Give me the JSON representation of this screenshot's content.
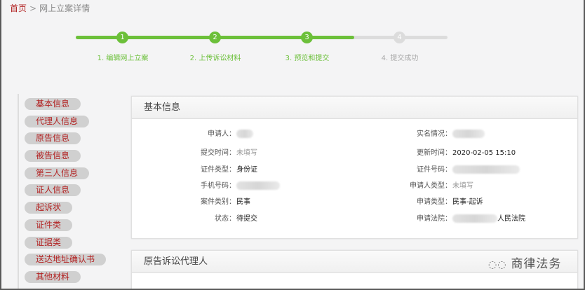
{
  "breadcrumb": {
    "home": "首页",
    "separator": ">",
    "current": "网上立案详情"
  },
  "steps": [
    {
      "num": "1",
      "label": "1. 编辑网上立案",
      "done": true
    },
    {
      "num": "2",
      "label": "2. 上传诉讼材料",
      "done": true
    },
    {
      "num": "3",
      "label": "3. 预览和提交",
      "done": true
    },
    {
      "num": "4",
      "label": "4. 提交成功",
      "done": false
    }
  ],
  "colors": {
    "accent": "#6cc03a",
    "inactive": "#dcdcdc",
    "link": "#b22222"
  },
  "sidebar": {
    "items": [
      "基本信息",
      "代理人信息",
      "原告信息",
      "被告信息",
      "第三人信息",
      "证人信息",
      "起诉状",
      "证件类",
      "证据类",
      "送达地址确认书",
      "其他材料"
    ]
  },
  "basic": {
    "title": "基本信息",
    "left": [
      {
        "label": "申请人：",
        "value": ""
      },
      {
        "label": "提交时间：",
        "value": "未填写"
      },
      {
        "label": "证件类型：",
        "value": "身份证"
      },
      {
        "label": "手机号码：",
        "value": ""
      },
      {
        "label": "案件类别：",
        "value": "民事"
      },
      {
        "label": "状态：",
        "value": "待提交"
      }
    ],
    "right": [
      {
        "label": "实名情况：",
        "value": ""
      },
      {
        "label": "更新时间：",
        "value": "2020-02-05 15:10"
      },
      {
        "label": "证件号码：",
        "value": ""
      },
      {
        "label": "申请人类型：",
        "value": "未填写"
      },
      {
        "label": "申请类型：",
        "value": "民事-起诉"
      },
      {
        "label": "申请法院：",
        "value": "人民法院"
      }
    ]
  },
  "agent_panel": {
    "title": "原告诉讼代理人"
  },
  "watermark": "商律法务"
}
